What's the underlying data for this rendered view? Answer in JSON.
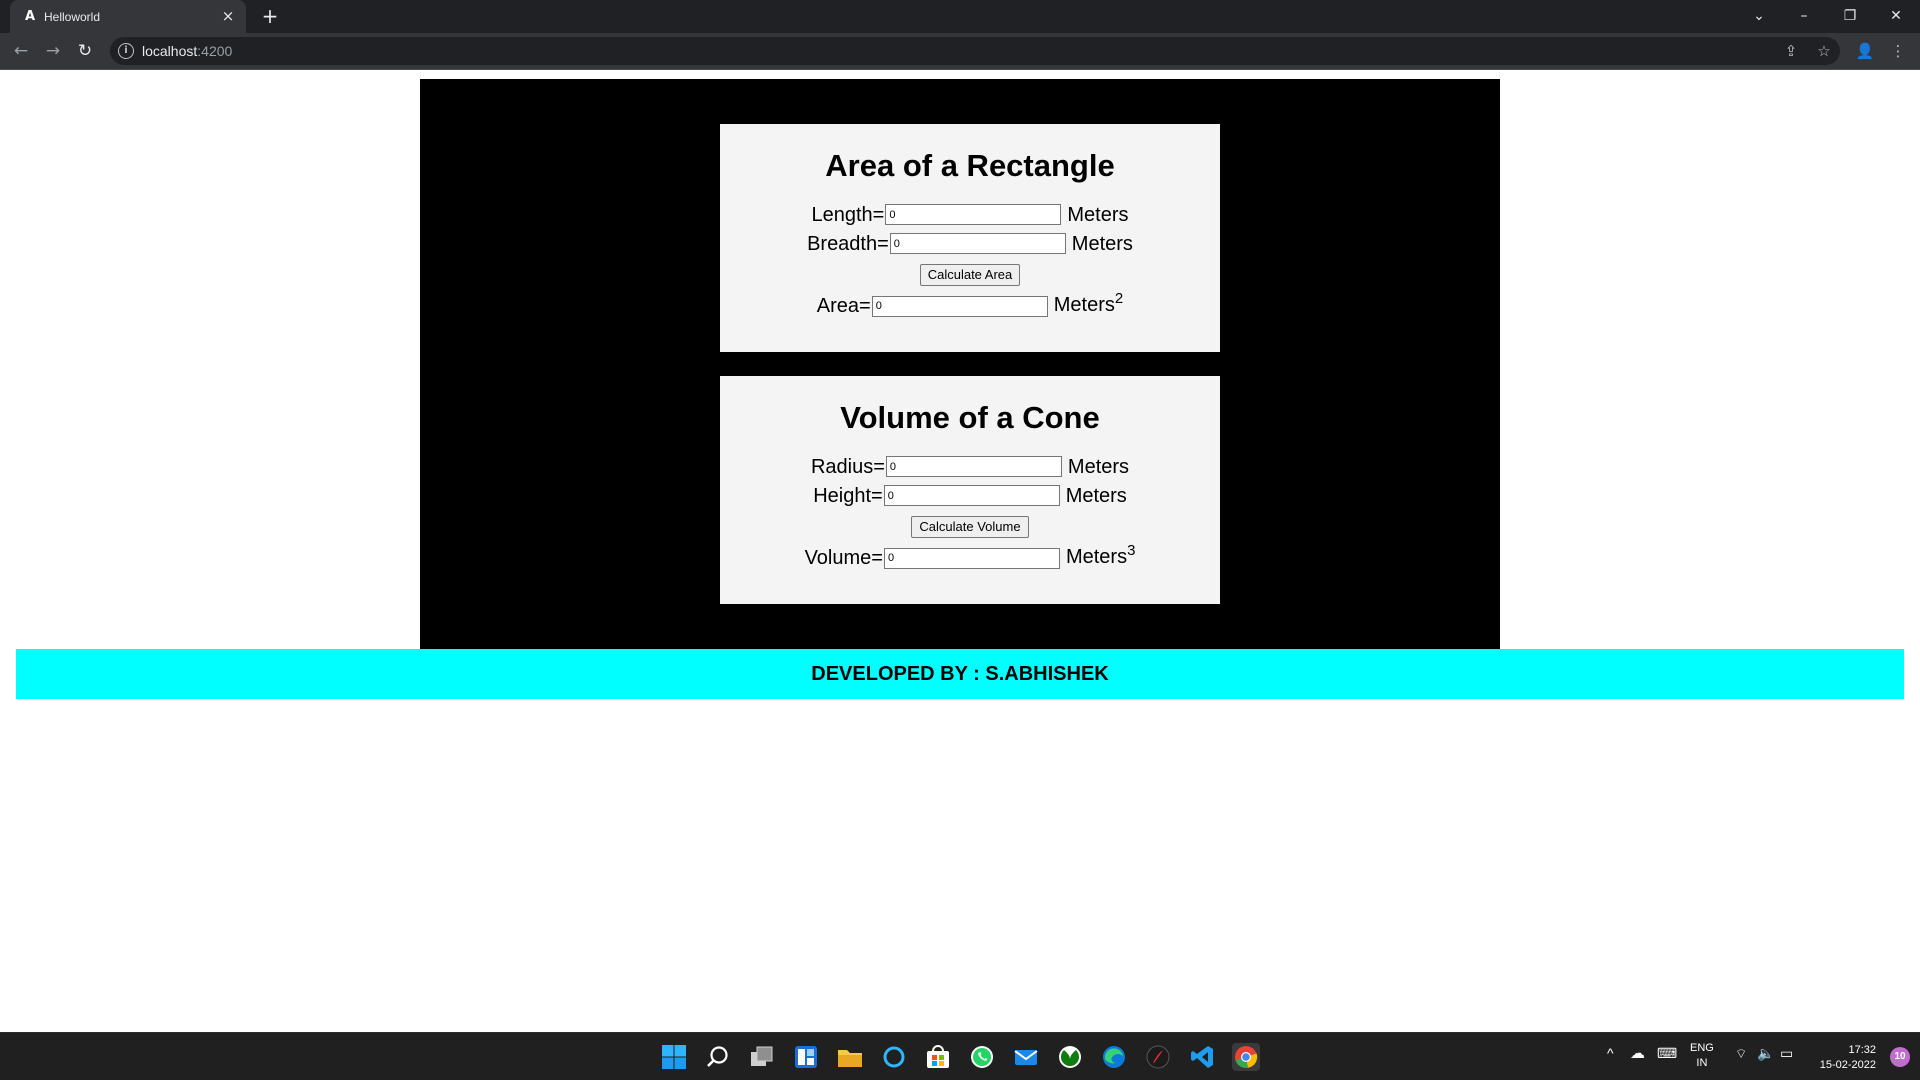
{
  "browser": {
    "tab_title": "Helloworld",
    "tab_favicon": "A",
    "url_host": "localhost",
    "url_port": ":4200"
  },
  "rectangle": {
    "title": "Area of a Rectangle",
    "length_label": "Length=",
    "length_value": "0",
    "breadth_label": "Breadth=",
    "breadth_value": "0",
    "unit": "Meters",
    "button_label": "Calculate Area",
    "area_label": "Area=",
    "area_value": "0",
    "area_unit": "Meters",
    "area_exponent": "2"
  },
  "cone": {
    "title": "Volume of a Cone",
    "radius_label": "Radius=",
    "radius_value": "0",
    "height_label": "Height=",
    "height_value": "0",
    "unit": "Meters",
    "button_label": "Calculate Volume",
    "volume_label": "Volume=",
    "volume_value": "0",
    "volume_unit": "Meters",
    "volume_exponent": "3"
  },
  "footer": {
    "text": "DEVELOPED BY : S.ABHISHEK"
  },
  "taskbar": {
    "lang_top": "ENG",
    "lang_bottom": "IN",
    "time": "17:32",
    "date": "15-02-2022",
    "notification_count": "10"
  }
}
